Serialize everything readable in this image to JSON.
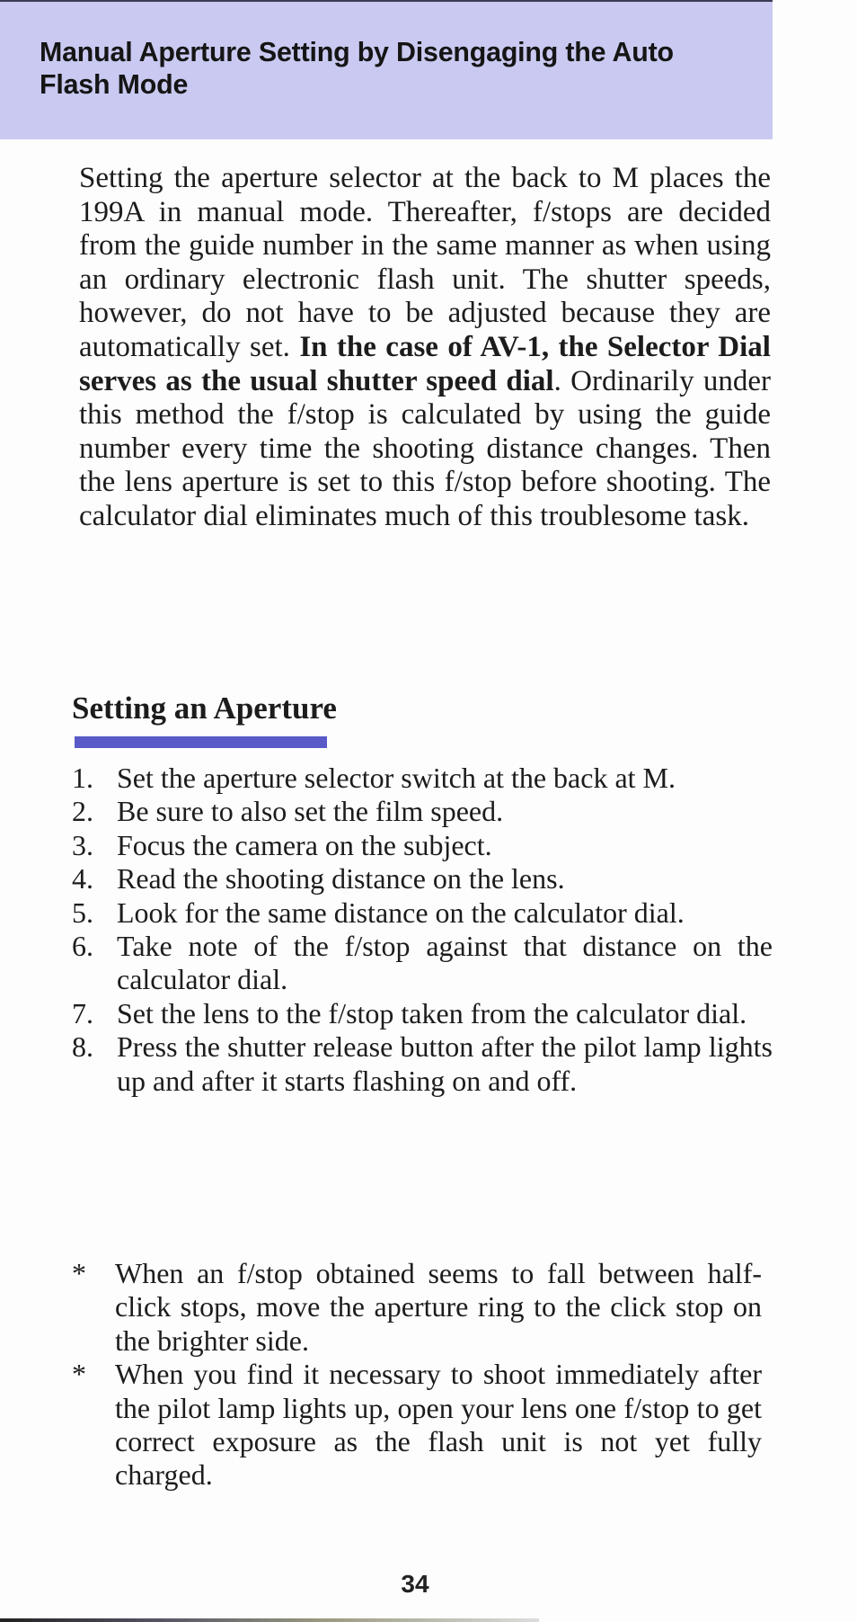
{
  "header": {
    "title": "Manual Aperture Setting by Disengaging the Auto Flash Mode",
    "band_color": "#c9c9f1"
  },
  "intro": {
    "text_before_bold": "Setting the aperture selector at the back to M places the 199A in manual mode. Thereafter, f/stops are decided from the guide number in the same manner as when using an ordinary electronic flash unit. The shutter speeds, however, do not have to be adjusted because they are automatically set. ",
    "bold_text": "In the case of AV-1, the Selector Dial serves as the usual shutter speed dial",
    "text_after_bold": ". Ordinarily under this method the f/stop is calculated by using the guide number every time the shooting dis­tance changes. Then the lens aperture is set to this f/stop before shooting. The calculator dial eliminates much of this troublesome task."
  },
  "section": {
    "heading": "Setting an Aperture",
    "underline_color": "#5959c8"
  },
  "steps": [
    {
      "num": "1.",
      "text": "Set the aperture selector switch at the back at M."
    },
    {
      "num": "2.",
      "text": "Be sure to also set the film speed."
    },
    {
      "num": "3.",
      "text": "Focus the camera on the subject."
    },
    {
      "num": "4.",
      "text": "Read the shooting distance on the lens."
    },
    {
      "num": "5.",
      "text": "Look for the same distance on the calcu­lator dial."
    },
    {
      "num": "6.",
      "text": "Take note of the f/stop against that distance on the calculator dial."
    },
    {
      "num": "7.",
      "text": "Set the lens to the f/stop taken from the calculator dial."
    },
    {
      "num": "8.",
      "text": "Press the shutter release button after the pilot lamp lights up and after it starts flash­ing on and off."
    }
  ],
  "notes": [
    {
      "mark": "*",
      "text": "When an f/stop obtained seems to fall between half-click stops, move the aperture ring to the click stop on the brighter side."
    },
    {
      "mark": "*",
      "text": "When you find it necessary to shoot immediately after the pilot lamp lights up, open your lens one f/stop to get correct exposure as the flash unit is not yet fully charged."
    }
  ],
  "page_number": "34"
}
